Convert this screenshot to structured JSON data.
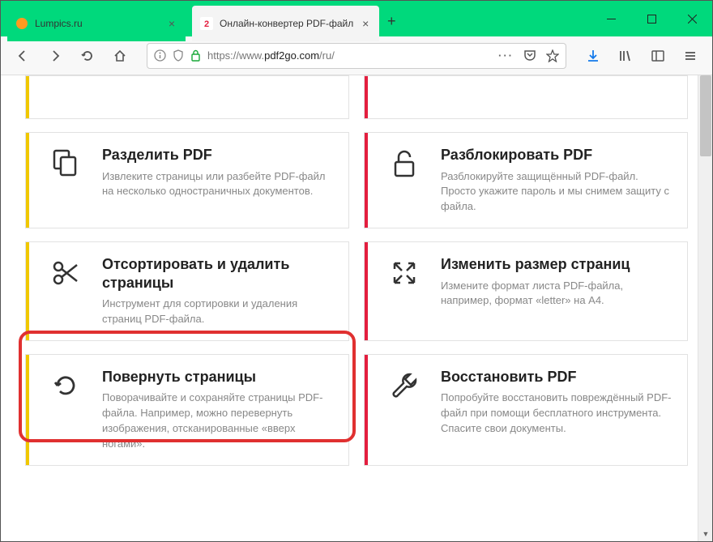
{
  "tabs": [
    {
      "title": "Lumpics.ru",
      "active": false
    },
    {
      "title": "Онлайн-конвертер PDF-файл",
      "active": true
    }
  ],
  "url": {
    "protocol": "https://",
    "prefix": "www.",
    "domain": "pdf2go.com",
    "path": "/ru/"
  },
  "cards": {
    "partial_left": {
      "title": "",
      "desc": ""
    },
    "partial_right": {
      "title": "",
      "desc": ""
    },
    "split": {
      "title": "Разделить PDF",
      "desc": "Извлеките страницы или разбейте PDF-файл на несколько одностраничных документов."
    },
    "unlock": {
      "title": "Разблокировать PDF",
      "desc": "Разблокируйте защищённый PDF-файл. Просто укажите пароль и мы снимем защиту с файла."
    },
    "sort": {
      "title": "Отсортировать и удалить страницы",
      "desc": "Инструмент для сортировки и удаления страниц PDF-файла."
    },
    "resize": {
      "title": "Изменить размер страниц",
      "desc": "Измените формат листа PDF-файла, например, формат «letter» на A4."
    },
    "rotate": {
      "title": "Повернуть страницы",
      "desc": "Поворачивайте и сохраняйте страницы PDF-файла. Например, можно перевернуть изображения, отсканированные «вверх ногами»."
    },
    "repair": {
      "title": "Восстановить PDF",
      "desc": "Попробуйте восстановить повреждённый PDF-файл при помощи бесплатного инструмента. Спасите свои документы."
    }
  }
}
